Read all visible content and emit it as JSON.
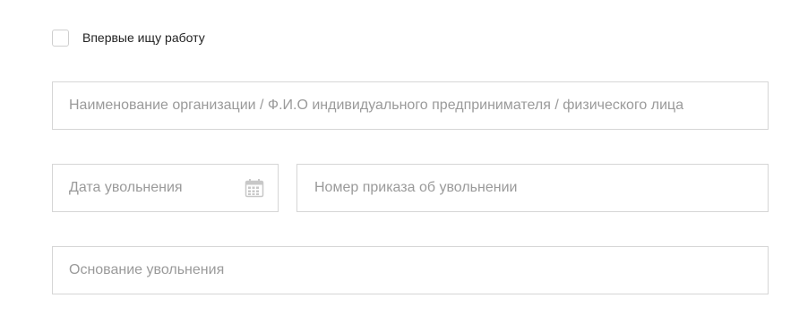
{
  "checkbox": {
    "label": "Впервые ищу работу",
    "checked": false
  },
  "fields": {
    "organization": {
      "placeholder": "Наименование организации / Ф.И.О индивидуального предпринимателя / физического лица",
      "value": ""
    },
    "dismissal_date": {
      "placeholder": "Дата увольнения",
      "value": "",
      "icon": "calendar-icon"
    },
    "dismissal_order_number": {
      "placeholder": "Номер приказа об увольнении",
      "value": ""
    },
    "dismissal_reason": {
      "placeholder": "Основание увольнения",
      "value": ""
    }
  },
  "colors": {
    "border": "#d6d6d6",
    "placeholder": "#9a9a9a",
    "label": "#222222",
    "icon": "#c8c8c8"
  }
}
